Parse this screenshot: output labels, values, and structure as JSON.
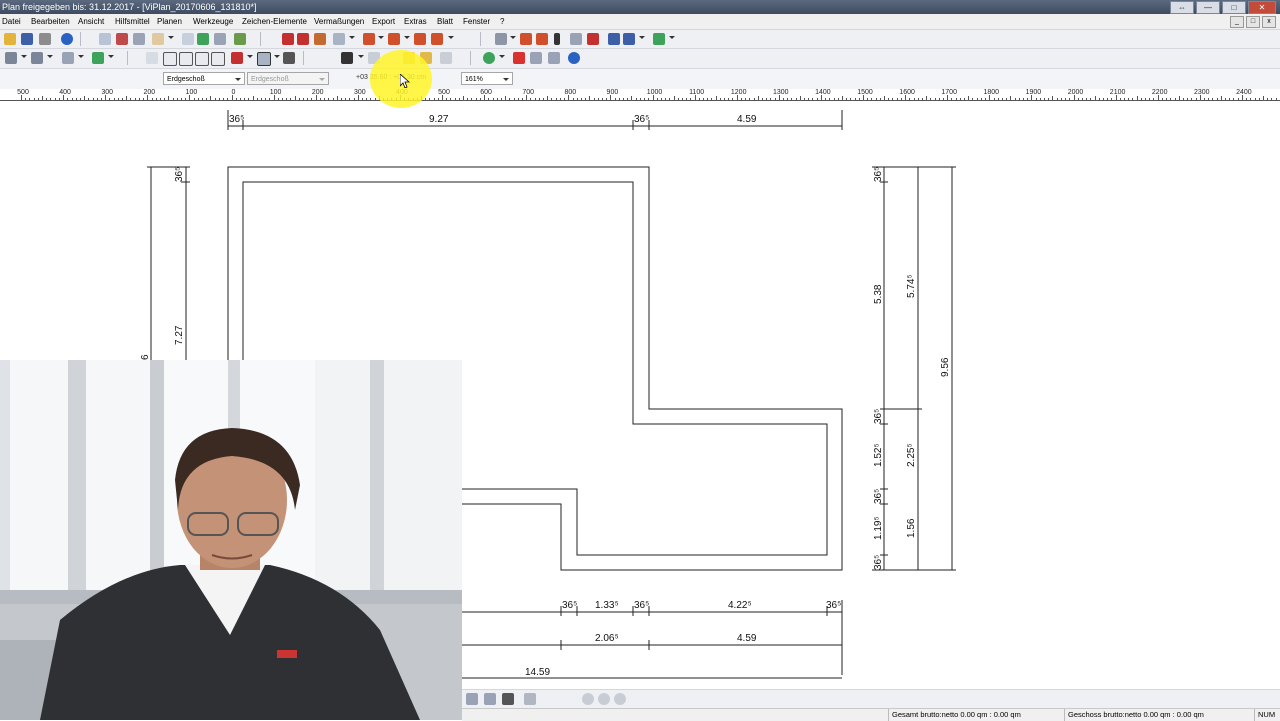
{
  "window": {
    "title": "Plan freigegeben bis: 31.12.2017 - [ViPlan_20170606_131810*]",
    "controls": [
      "⇔",
      "—",
      "□",
      "✕"
    ]
  },
  "menu": {
    "items": [
      "Datei",
      "Bearbeiten",
      "Ansicht",
      "Hilfsmittel",
      "Planen",
      "Werkzeuge",
      "Zeichen-Elemente",
      "Vermaßungen",
      "Export",
      "Extras",
      "Blatt",
      "Fenster",
      "?"
    ],
    "mdi_controls": [
      "_",
      "□",
      "x"
    ]
  },
  "toolbar3": {
    "floor_primary": "Erdgeschoß",
    "floor_secondary": "Erdgeschoß",
    "coordinates": "+03 35.60 : +08.30 cm",
    "zoom": "161%"
  },
  "ruler": {
    "labels": [
      "500",
      "400",
      "300",
      "200",
      "100",
      "0",
      "100",
      "200",
      "300",
      "400",
      "500",
      "600",
      "700",
      "800",
      "900",
      "1000",
      "1100",
      "1200",
      "1300",
      "1400",
      "1500",
      "1600",
      "1700",
      "1800",
      "1900",
      "2000",
      "2100",
      "2200",
      "2300",
      "2400"
    ]
  },
  "dimensions": {
    "top": [
      "36⁵",
      "9.27",
      "36⁵",
      "4.59"
    ],
    "left": [
      "36⁵",
      "7.27",
      "6"
    ],
    "right_inner": [
      "36⁵",
      "5.38",
      "36⁵",
      "1.52⁵",
      "36⁵",
      "1.19⁵",
      "36⁵"
    ],
    "right_middle": [
      "5.74⁵",
      "2.25⁵",
      "1.56"
    ],
    "right_outer": [
      "9.56"
    ],
    "bottom_row1": [
      "36⁵",
      "1.33⁵",
      "36⁵",
      "4.22⁵",
      "36⁵"
    ],
    "bottom_row2": [
      "2.06⁵",
      "4.59"
    ],
    "bottom_row3": [
      "14.59"
    ]
  },
  "statusbar": {
    "gesamt": "Gesamt brutto:netto 0.00 qm : 0.00 qm",
    "geschoss": "Geschoss brutto:netto 0.00 qm : 0.00 qm",
    "num": "NUM"
  },
  "colors": {
    "titlebar": "#4a5870",
    "highlight": "#fff528",
    "toolbar": "#eef0f4"
  }
}
